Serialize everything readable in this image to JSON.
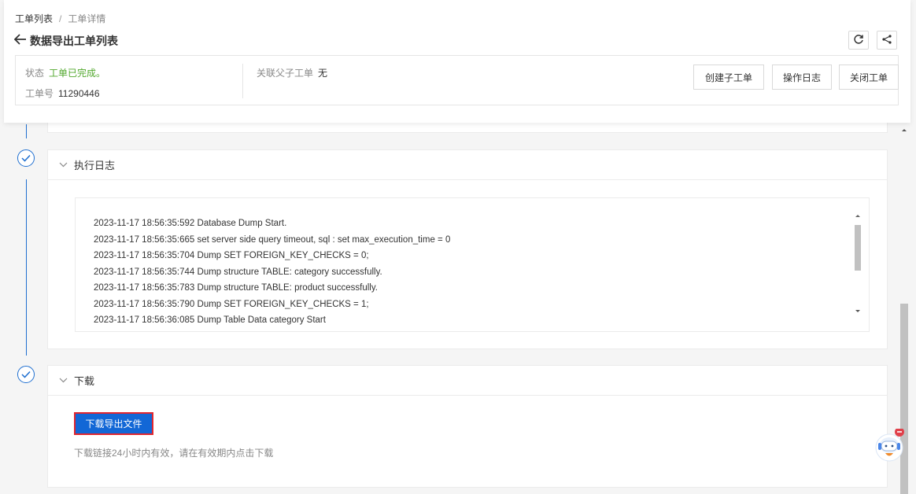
{
  "breadcrumb": {
    "root": "工单列表",
    "separator": "/",
    "current": "工单详情"
  },
  "header": {
    "back_icon": "arrow-left-icon",
    "title": "数据导出工单列表"
  },
  "info": {
    "status_label": "状态",
    "status_value": "工单已完成。",
    "ticket_label": "工单号",
    "ticket_value": "11290446",
    "related_label": "关联父子工单",
    "related_value": "无"
  },
  "actions": {
    "create_child": "创建子工单",
    "operation_log": "操作日志",
    "close_ticket": "关闭工单"
  },
  "log_section": {
    "title": "执行日志",
    "lines": [
      "2023-11-17 18:56:35:592 Database Dump Start.",
      "2023-11-17 18:56:35:665 set server side query timeout, sql : set max_execution_time = 0",
      "2023-11-17 18:56:35:704 Dump SET FOREIGN_KEY_CHECKS = 0;",
      "2023-11-17 18:56:35:744 Dump structure TABLE: category successfully.",
      "2023-11-17 18:56:35:783 Dump structure TABLE: product successfully.",
      "2023-11-17 18:56:35:790 Dump SET FOREIGN_KEY_CHECKS = 1;",
      "2023-11-17 18:56:36:085 Dump Table Data category Start"
    ]
  },
  "download_section": {
    "title": "下载",
    "button_label": "下载导出文件",
    "note": "下载链接24小时内有效，请在有效期内点击下载"
  },
  "colors": {
    "accent": "#1267d6",
    "success": "#52a82e",
    "highlight_border": "#e0262f",
    "timeline": "#1f6fd0"
  }
}
